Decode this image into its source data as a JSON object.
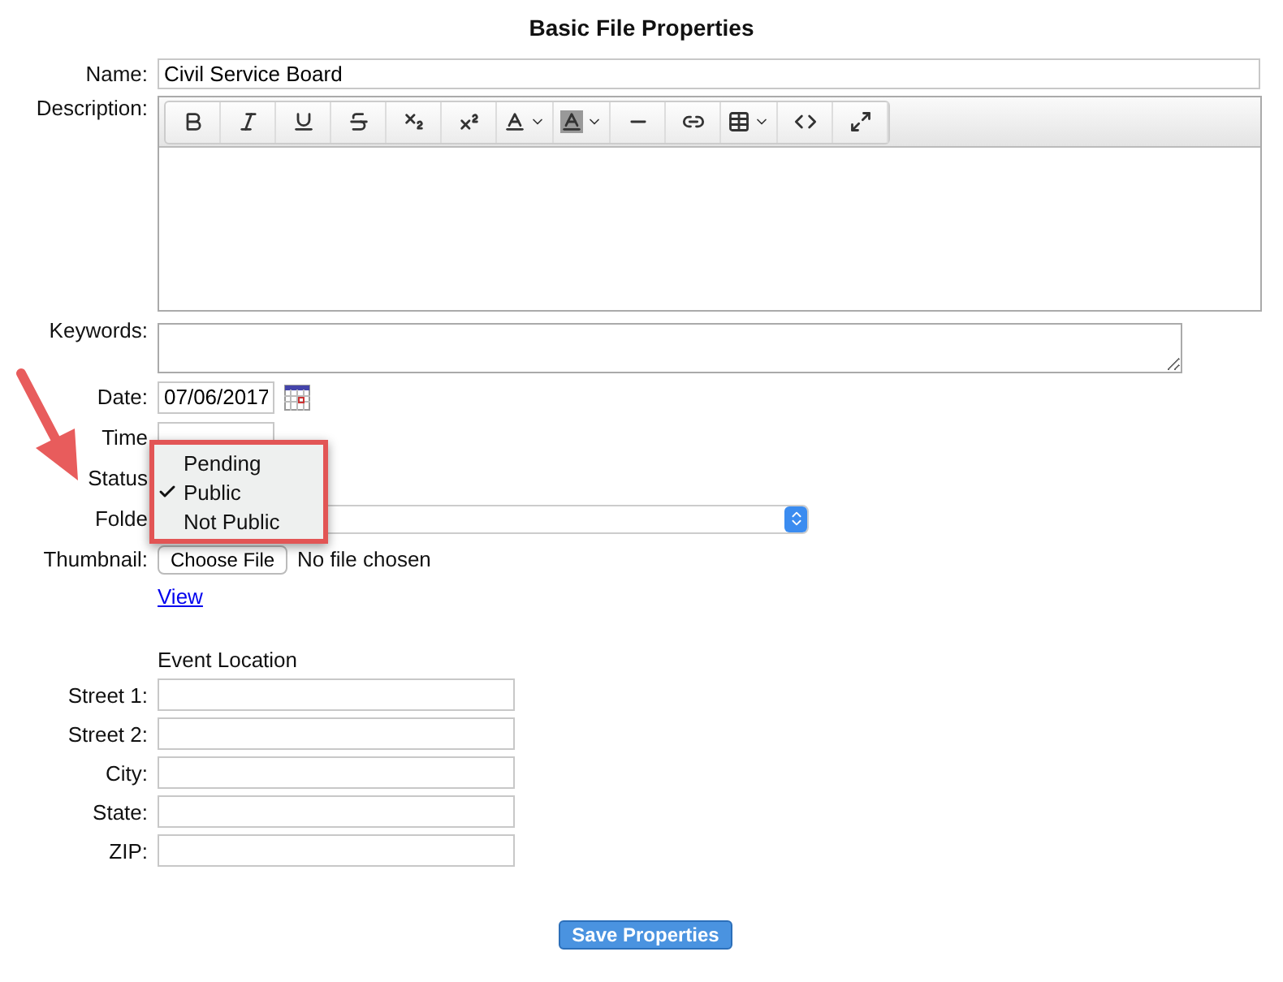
{
  "title": "Basic File Properties",
  "name": {
    "label": "Name:",
    "value": "Civil Service Board"
  },
  "description": {
    "label": "Description:"
  },
  "keywords": {
    "label": "Keywords:"
  },
  "date": {
    "label": "Date:",
    "value": "07/06/2017"
  },
  "time": {
    "label": "Time"
  },
  "status": {
    "label": "Status",
    "options": [
      {
        "label": "Pending",
        "selected": false
      },
      {
        "label": "Public",
        "selected": true
      },
      {
        "label": "Not Public",
        "selected": false
      }
    ]
  },
  "folder": {
    "label": "Folde"
  },
  "thumbnail": {
    "label": "Thumbnail:",
    "button": "Choose File",
    "file": "No file chosen",
    "link": "View"
  },
  "event_location": {
    "heading": "Event Location",
    "fields": [
      {
        "label": "Street 1:"
      },
      {
        "label": "Street 2:"
      },
      {
        "label": "City:"
      },
      {
        "label": "State:"
      },
      {
        "label": "ZIP:"
      }
    ]
  },
  "save_button": "Save Properties"
}
